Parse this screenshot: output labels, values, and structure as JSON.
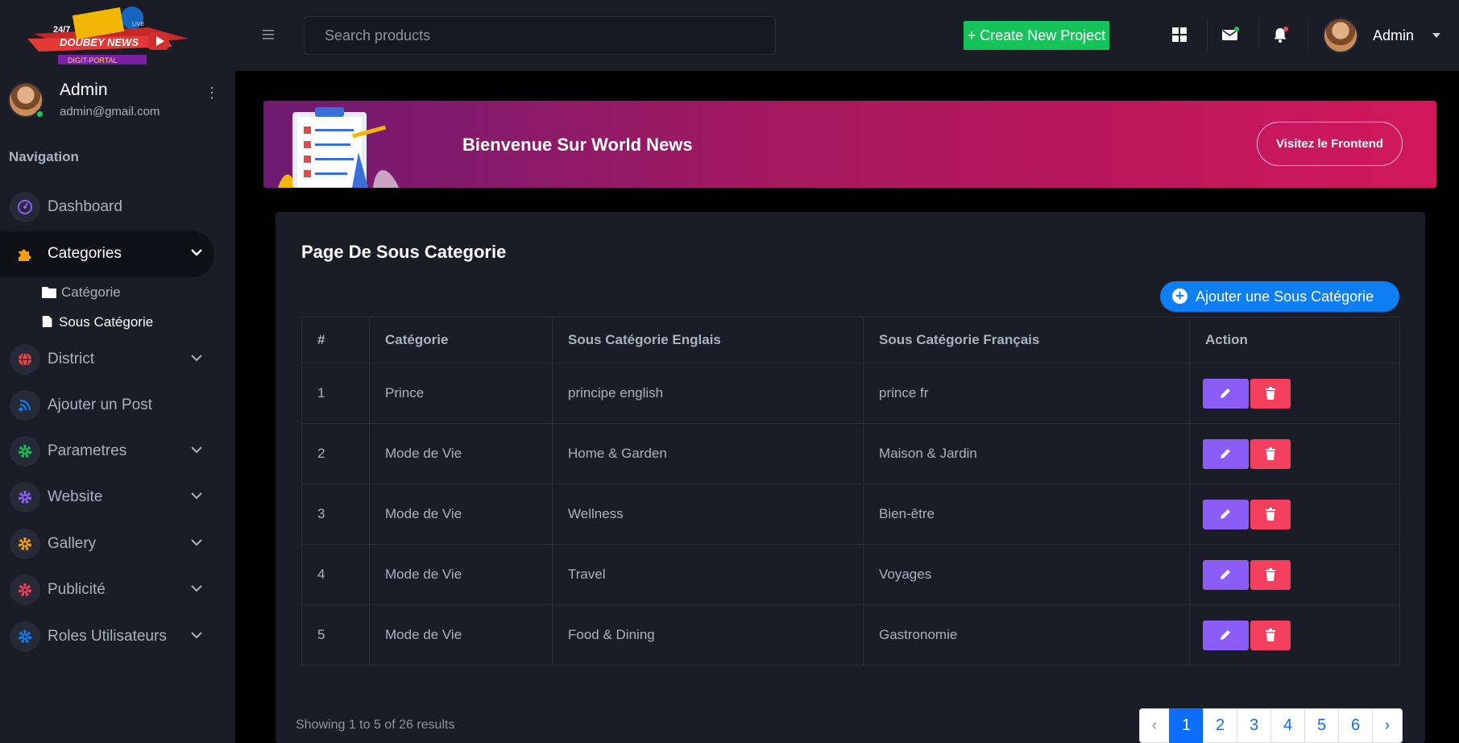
{
  "logo": {
    "line1": "24/7",
    "line2": "DOUBEY NEWS",
    "line3": "DIGIT-PORTAL",
    "badge": "LIVE"
  },
  "user": {
    "name": "Admin",
    "email": "admin@gmail.com"
  },
  "sidebar": {
    "heading": "Navigation",
    "items": [
      {
        "label": "Dashboard",
        "icon": "dashboard-icon",
        "color": "#8b5cf6"
      },
      {
        "label": "Categories",
        "icon": "puzzle-icon",
        "color": "#f59e0b"
      },
      {
        "label": "District",
        "icon": "globe-icon",
        "color": "#ef4444"
      },
      {
        "label": "Ajouter un Post",
        "icon": "broadcast-icon",
        "color": "#0d7ff2"
      },
      {
        "label": "Parametres",
        "icon": "gear-icon",
        "color": "#16c25a"
      },
      {
        "label": "Website",
        "icon": "gear-icon",
        "color": "#8b5cf6"
      },
      {
        "label": "Gallery",
        "icon": "gear-icon",
        "color": "#f59e0b"
      },
      {
        "label": "Publicité",
        "icon": "gear-icon",
        "color": "#f43f5e"
      },
      {
        "label": "Roles Utilisateurs",
        "icon": "gear-icon",
        "color": "#0d7ff2"
      }
    ],
    "subitems": [
      {
        "label": "Catégorie",
        "icon": "folder-icon"
      },
      {
        "label": "Sous Catégorie",
        "icon": "file-icon"
      }
    ]
  },
  "header": {
    "search_placeholder": "Search products",
    "create_label": "+ Create New Project",
    "user_name": "Admin"
  },
  "banner": {
    "title": "Bienvenue Sur World News",
    "button": "Visitez le Frontend"
  },
  "page": {
    "title": "Page De Sous Categorie",
    "add_button": "Ajouter une Sous Catégorie"
  },
  "table": {
    "headers": [
      "#",
      "Catégorie",
      "Sous Catégorie Englais",
      "Sous Catégorie Français",
      "Action"
    ],
    "rows": [
      [
        "1",
        "Prince",
        "principe english",
        "prince fr"
      ],
      [
        "2",
        "Mode de Vie",
        "Home & Garden",
        "Maison & Jardin"
      ],
      [
        "3",
        "Mode de Vie",
        "Wellness",
        "Bien-être"
      ],
      [
        "4",
        "Mode de Vie",
        "Travel",
        "Voyages"
      ],
      [
        "5",
        "Mode de Vie",
        "Food & Dining",
        "Gastronomie"
      ]
    ]
  },
  "pagination": {
    "summary": "Showing 1 to 5 of 26 results",
    "prev": "‹",
    "next": "›",
    "pages": [
      "1",
      "2",
      "3",
      "4",
      "5",
      "6"
    ],
    "current": "1"
  },
  "colors": {
    "accent_blue": "#0d7ff2",
    "create_green": "#16c25a",
    "edit_purple": "#8b5cf6",
    "delete_red": "#f43f5e",
    "banner_start": "#6f1a73",
    "banner_end": "#d1185a"
  }
}
